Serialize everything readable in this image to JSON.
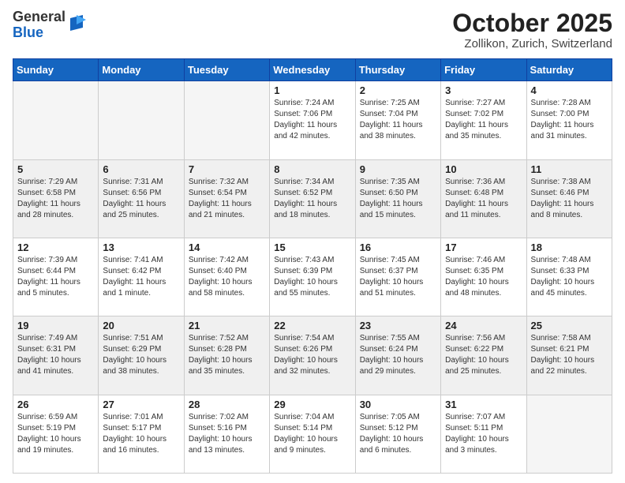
{
  "header": {
    "logo_general": "General",
    "logo_blue": "Blue",
    "month_title": "October 2025",
    "location": "Zollikon, Zurich, Switzerland"
  },
  "days_of_week": [
    "Sunday",
    "Monday",
    "Tuesday",
    "Wednesday",
    "Thursday",
    "Friday",
    "Saturday"
  ],
  "weeks": [
    [
      {
        "day": "",
        "info": ""
      },
      {
        "day": "",
        "info": ""
      },
      {
        "day": "",
        "info": ""
      },
      {
        "day": "1",
        "info": "Sunrise: 7:24 AM\nSunset: 7:06 PM\nDaylight: 11 hours\nand 42 minutes."
      },
      {
        "day": "2",
        "info": "Sunrise: 7:25 AM\nSunset: 7:04 PM\nDaylight: 11 hours\nand 38 minutes."
      },
      {
        "day": "3",
        "info": "Sunrise: 7:27 AM\nSunset: 7:02 PM\nDaylight: 11 hours\nand 35 minutes."
      },
      {
        "day": "4",
        "info": "Sunrise: 7:28 AM\nSunset: 7:00 PM\nDaylight: 11 hours\nand 31 minutes."
      }
    ],
    [
      {
        "day": "5",
        "info": "Sunrise: 7:29 AM\nSunset: 6:58 PM\nDaylight: 11 hours\nand 28 minutes."
      },
      {
        "day": "6",
        "info": "Sunrise: 7:31 AM\nSunset: 6:56 PM\nDaylight: 11 hours\nand 25 minutes."
      },
      {
        "day": "7",
        "info": "Sunrise: 7:32 AM\nSunset: 6:54 PM\nDaylight: 11 hours\nand 21 minutes."
      },
      {
        "day": "8",
        "info": "Sunrise: 7:34 AM\nSunset: 6:52 PM\nDaylight: 11 hours\nand 18 minutes."
      },
      {
        "day": "9",
        "info": "Sunrise: 7:35 AM\nSunset: 6:50 PM\nDaylight: 11 hours\nand 15 minutes."
      },
      {
        "day": "10",
        "info": "Sunrise: 7:36 AM\nSunset: 6:48 PM\nDaylight: 11 hours\nand 11 minutes."
      },
      {
        "day": "11",
        "info": "Sunrise: 7:38 AM\nSunset: 6:46 PM\nDaylight: 11 hours\nand 8 minutes."
      }
    ],
    [
      {
        "day": "12",
        "info": "Sunrise: 7:39 AM\nSunset: 6:44 PM\nDaylight: 11 hours\nand 5 minutes."
      },
      {
        "day": "13",
        "info": "Sunrise: 7:41 AM\nSunset: 6:42 PM\nDaylight: 11 hours\nand 1 minute."
      },
      {
        "day": "14",
        "info": "Sunrise: 7:42 AM\nSunset: 6:40 PM\nDaylight: 10 hours\nand 58 minutes."
      },
      {
        "day": "15",
        "info": "Sunrise: 7:43 AM\nSunset: 6:39 PM\nDaylight: 10 hours\nand 55 minutes."
      },
      {
        "day": "16",
        "info": "Sunrise: 7:45 AM\nSunset: 6:37 PM\nDaylight: 10 hours\nand 51 minutes."
      },
      {
        "day": "17",
        "info": "Sunrise: 7:46 AM\nSunset: 6:35 PM\nDaylight: 10 hours\nand 48 minutes."
      },
      {
        "day": "18",
        "info": "Sunrise: 7:48 AM\nSunset: 6:33 PM\nDaylight: 10 hours\nand 45 minutes."
      }
    ],
    [
      {
        "day": "19",
        "info": "Sunrise: 7:49 AM\nSunset: 6:31 PM\nDaylight: 10 hours\nand 41 minutes."
      },
      {
        "day": "20",
        "info": "Sunrise: 7:51 AM\nSunset: 6:29 PM\nDaylight: 10 hours\nand 38 minutes."
      },
      {
        "day": "21",
        "info": "Sunrise: 7:52 AM\nSunset: 6:28 PM\nDaylight: 10 hours\nand 35 minutes."
      },
      {
        "day": "22",
        "info": "Sunrise: 7:54 AM\nSunset: 6:26 PM\nDaylight: 10 hours\nand 32 minutes."
      },
      {
        "day": "23",
        "info": "Sunrise: 7:55 AM\nSunset: 6:24 PM\nDaylight: 10 hours\nand 29 minutes."
      },
      {
        "day": "24",
        "info": "Sunrise: 7:56 AM\nSunset: 6:22 PM\nDaylight: 10 hours\nand 25 minutes."
      },
      {
        "day": "25",
        "info": "Sunrise: 7:58 AM\nSunset: 6:21 PM\nDaylight: 10 hours\nand 22 minutes."
      }
    ],
    [
      {
        "day": "26",
        "info": "Sunrise: 6:59 AM\nSunset: 5:19 PM\nDaylight: 10 hours\nand 19 minutes."
      },
      {
        "day": "27",
        "info": "Sunrise: 7:01 AM\nSunset: 5:17 PM\nDaylight: 10 hours\nand 16 minutes."
      },
      {
        "day": "28",
        "info": "Sunrise: 7:02 AM\nSunset: 5:16 PM\nDaylight: 10 hours\nand 13 minutes."
      },
      {
        "day": "29",
        "info": "Sunrise: 7:04 AM\nSunset: 5:14 PM\nDaylight: 10 hours\nand 9 minutes."
      },
      {
        "day": "30",
        "info": "Sunrise: 7:05 AM\nSunset: 5:12 PM\nDaylight: 10 hours\nand 6 minutes."
      },
      {
        "day": "31",
        "info": "Sunrise: 7:07 AM\nSunset: 5:11 PM\nDaylight: 10 hours\nand 3 minutes."
      },
      {
        "day": "",
        "info": ""
      }
    ]
  ]
}
